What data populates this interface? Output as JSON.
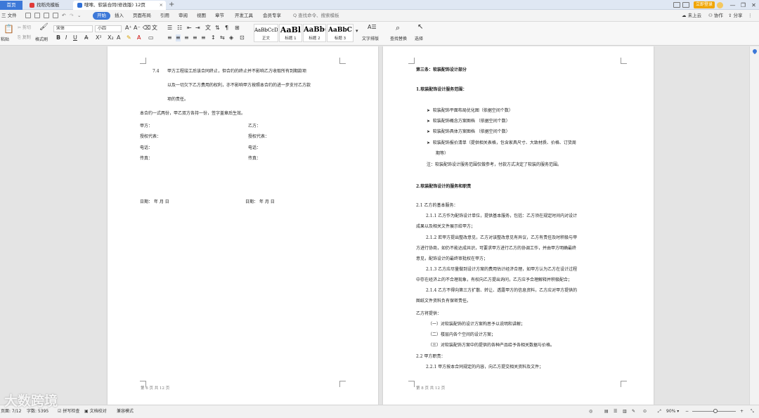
{
  "tabs": {
    "home": "首页",
    "find_template": "找稻壳模板",
    "document": "嗖嗦、软装合同(修改版) 12页",
    "document_close": "×",
    "new": "+"
  },
  "titlebar": {
    "login": "立即登录",
    "minimize": "—",
    "maximize": "❐",
    "close": "✕"
  },
  "menu": {
    "file": "三 文件",
    "items": [
      "开始",
      "插入",
      "页面布局",
      "引用",
      "审阅",
      "视图",
      "章节",
      "开发工具",
      "会员专享"
    ],
    "search": "Q 查找命令、搜索模板",
    "cloud": "未上云",
    "collab": "协作",
    "share": "分享"
  },
  "ribbon": {
    "paste": "粘贴",
    "cut": "剪切",
    "copy": "复制",
    "format_painter": "格式刷",
    "font_name": "宋体",
    "font_size": "小四",
    "styles": [
      {
        "sample": "AaBbCcDd",
        "label": "正文"
      },
      {
        "sample": "AaBl",
        "label": "标题 1"
      },
      {
        "sample": "AaBb(",
        "label": "标题 2"
      },
      {
        "sample": "AaBbC",
        "label": "标题 3"
      }
    ],
    "text_layout": "文字排版",
    "find_replace": "查找替换",
    "select": "选择"
  },
  "left_page": {
    "clause_74_num": "7.4",
    "clause_74_lines": [
      "甲方工程竣工后该合同终止，但合约的终止并不影响乙方收取所有到期款项",
      "以及一切欠下乙方费用的权利，亦不影响甲方按照本合约的进一步支付乙方款",
      "项的责任。"
    ],
    "copies_line": "本合约一式两份，甲乙双方各持一份，签字盖章后生效。",
    "sign_left": [
      "甲方：",
      "授权代表：",
      "电话：",
      "传真："
    ],
    "sign_right": [
      "乙方：",
      "授权代表：",
      "电话：",
      "传真："
    ],
    "date_left": "日期：            年        月        日",
    "date_right": "日期：            年        月        日",
    "footer": "第 6 页 共 12 页"
  },
  "right_page": {
    "heading": "第三条：软装配饰设计部分",
    "sec1": "1.软装配饰设计服务范围：",
    "bullets": [
      "软装配饰平面布局优化图（依据空间个数）",
      "软装配饰概念方案图档    （依据空间个数）",
      "软装配饰具体方案图档    （依据空间个数）",
      "软装配饰报价清单（提供相关表格，包含家具尺寸、大致材质、价格、订货周"
    ],
    "bullet_cont": "期等）",
    "note": "注：软装配饰设计服务范围仅做参考，付款方式决定了软装的服务范围。",
    "sec2": "2.软装配饰设计的服务和职责",
    "s21": "2.1 乙方的基本服务：",
    "body_lines": [
      "2.1.1 乙方作为配饰设计单位，提供基本服务，包括：乙方须在规定时间内对设计",
      "成果以及相关文件展示给甲方；",
      "2.1.2 若甲方提出整改意见，乙方对该整改意见有异议，乙方有责任及时积极与甲",
      "方进行协商，如仍不能达成共识，可要求甲方进行乙方的协调工作，并由甲方明确最终",
      "意见，配饰设计的最终审批权在甲方；",
      "2.1.3 乙方应尽量做到设计方案的费用估计经济合理，如甲方认为乙方在设计过程",
      "中存在经济上的不合理现象，有权向乙方提出询问，乙方应予合理解释并积极配合；",
      "2.1.4 乙方不得向第三方扩散、转让、透露甲方的信息资料，乙方应对甲方提供的",
      "图纸文件资料负有保密责任。"
    ],
    "provide": "乙方将提供：",
    "provide_items": [
      "（一）对软装配饰的设计方案构思予以说明和讲解；",
      "（二）楼层内各个空间的设计方案；",
      "（三）对软装配饰方案中的提供的各种产品给予各相关数据与价格。"
    ],
    "s22": "2.2 甲方职责：",
    "s221": "2.2.1 甲方按本合同规定的内容，向乙方提交相关资料及文件；",
    "footer": "第 8 页 共 12 页"
  },
  "status": {
    "page": "页面: 7/12",
    "words": "字数: 5395",
    "spell": "拼写检查",
    "proof": "文档校对",
    "compat": "兼容模式",
    "zoom": "90%",
    "zoom_minus": "−",
    "zoom_plus": "+"
  },
  "watermark": "大数跨境",
  "colors": {
    "accent": "#3c78d8",
    "login": "#f0a500",
    "page": "#ffffff",
    "canvas": "#e4e4e4"
  }
}
